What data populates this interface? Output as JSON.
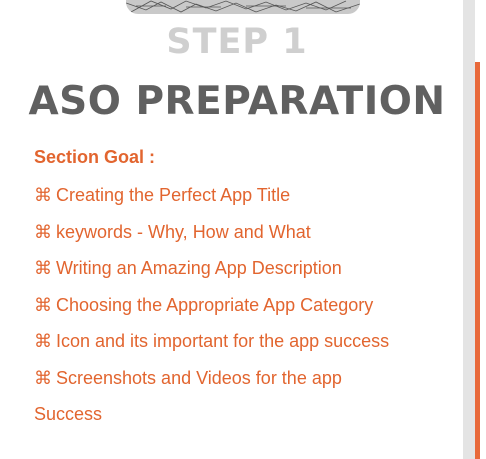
{
  "slide": {
    "step_label": "STEP 1",
    "title": "ASO PREPARATION",
    "section_goal_label": "Section Goal :",
    "bullet_glyph": "⌘",
    "goals": [
      "Creating the Perfect App Title",
      "keywords - Why, How and What",
      "Writing an Amazing App Description",
      "Choosing the Appropriate App Category",
      "Icon and its important for the app success",
      "Screenshots and Videos for the app",
      "Success"
    ]
  },
  "colors": {
    "accent": "#e2652f",
    "title": "#606060",
    "step": "#cfcfcf",
    "frame_orange": "#e8693a",
    "frame_gray": "#e4e4e4"
  }
}
